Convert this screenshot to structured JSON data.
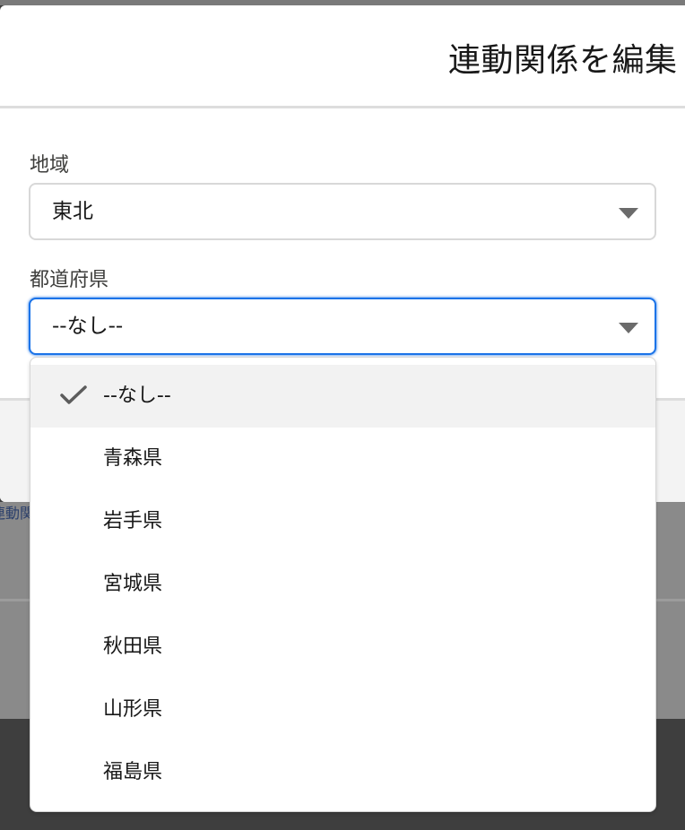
{
  "modal": {
    "title": "連動関係を編集"
  },
  "background": {
    "link_text": "連動関係"
  },
  "fields": {
    "region": {
      "label": "地域",
      "value": "東北"
    },
    "prefecture": {
      "label": "都道府県",
      "value": "--なし--"
    }
  },
  "dropdown": {
    "options": [
      {
        "label": "--なし--",
        "selected": true
      },
      {
        "label": "青森県",
        "selected": false
      },
      {
        "label": "岩手県",
        "selected": false
      },
      {
        "label": "宮城県",
        "selected": false
      },
      {
        "label": "秋田県",
        "selected": false
      },
      {
        "label": "山形県",
        "selected": false
      },
      {
        "label": "福島県",
        "selected": false
      }
    ]
  },
  "colors": {
    "focus_border": "#1b73e8",
    "selected_option_bg": "#f2f2f2"
  }
}
